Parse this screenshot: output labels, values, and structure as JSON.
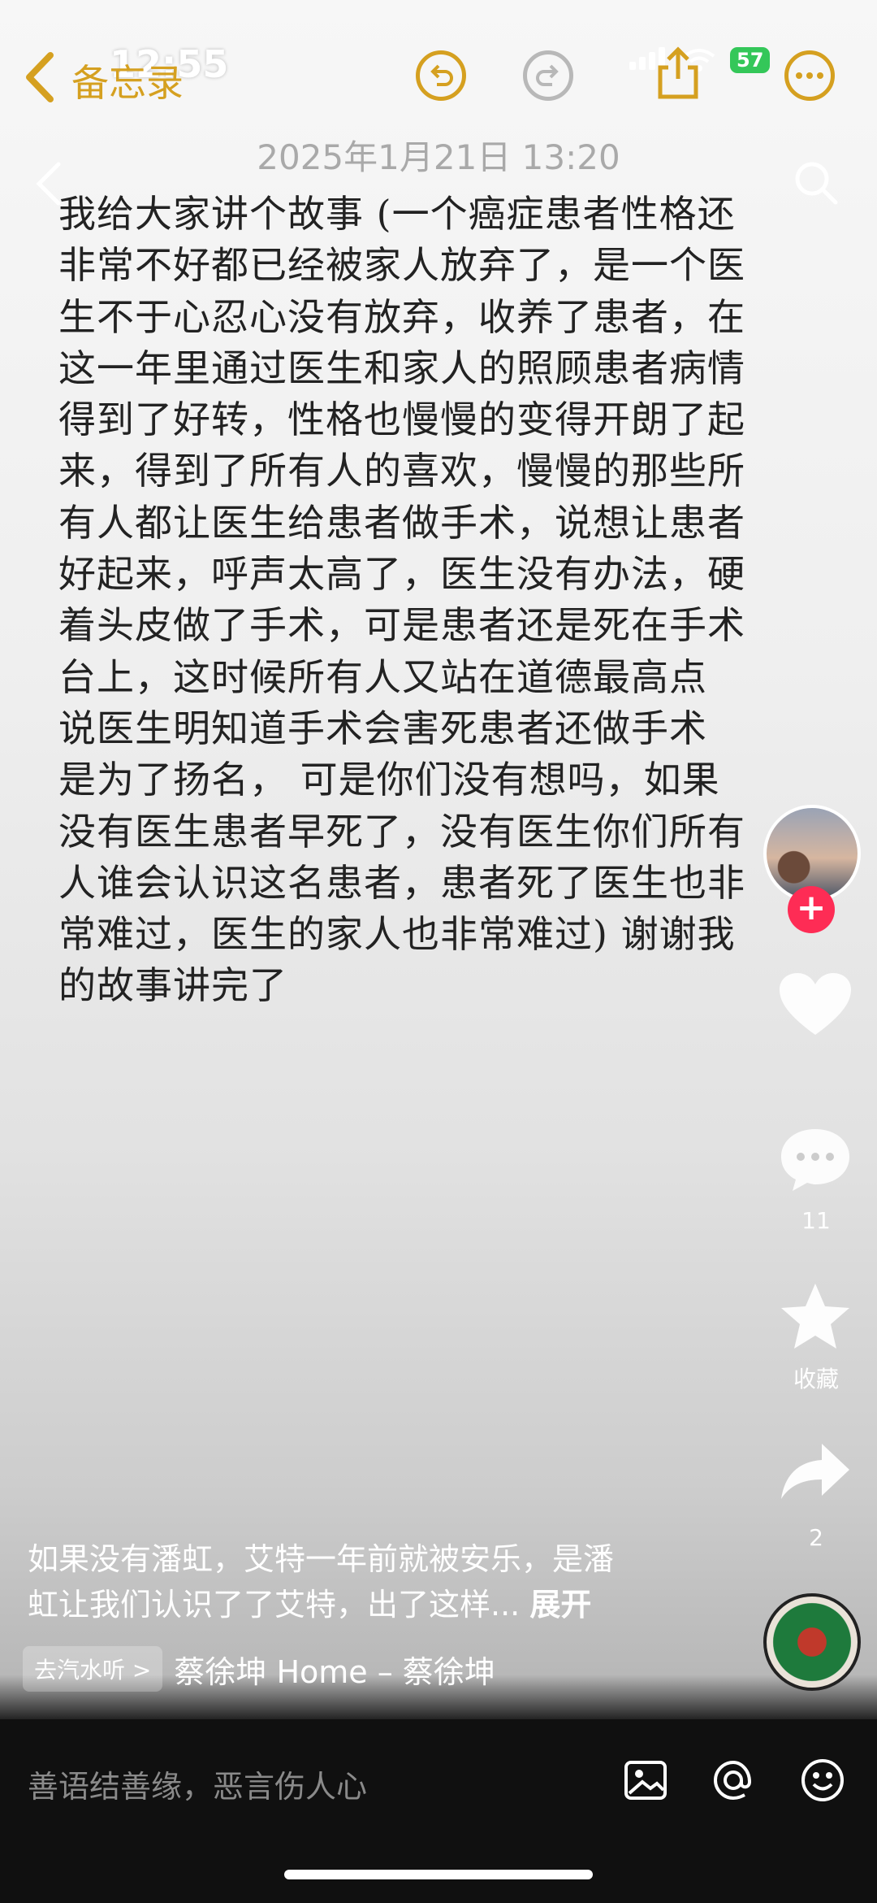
{
  "status_bar": {
    "time": "12:55",
    "battery": "57"
  },
  "notes_header": {
    "back_label": "备忘录"
  },
  "note": {
    "date": "2025年1月21日 13:20",
    "lines": [
      "我给大家讲个故事 (一个癌症患者性格还",
      "非常不好都已经被家人放弃了，是一个医",
      "生不于心忍心没有放弃，收养了患者，在",
      "这一年里通过医生和家人的照顾患者病情",
      "得到了好转，性格也慢慢的变得开朗了起",
      "来，得到了所有人的喜欢，慢慢的那些所",
      "有人都让医生给患者做手术，说想让患者",
      "好起来，呼声太高了，医生没有办法，硬",
      "着头皮做了手术，可是患者还是死在手术",
      "台上，这时候所有人又站在道德最高点",
      "说医生明知道手术会害死患者还做手术",
      "是为了扬名， 可是你们没有想吗，如果",
      "没有医生患者早死了，没有医生你们所有",
      "人谁会认识这名患者，患者死了医生也非",
      "常难过，医生的家人也非常难过) 谢谢我",
      "的故事讲完了"
    ]
  },
  "rail": {
    "comment_count": "11",
    "favorite_label": "收藏",
    "share_count": "2"
  },
  "caption": {
    "line1": "如果没有潘虹，艾特一年前就被安乐，是潘",
    "line2": "虹让我们认识了了艾特，出了这样...",
    "expand": "展开"
  },
  "music": {
    "chip": "去汽水听 >",
    "text": "蔡徐坤    Home – 蔡徐坤"
  },
  "comment_bar": {
    "placeholder": "善语结善缘，恶言伤人心"
  },
  "colors": {
    "notes_gold": "#d5a020",
    "follow_red": "#fe2c55",
    "battery_green": "#34c759"
  }
}
